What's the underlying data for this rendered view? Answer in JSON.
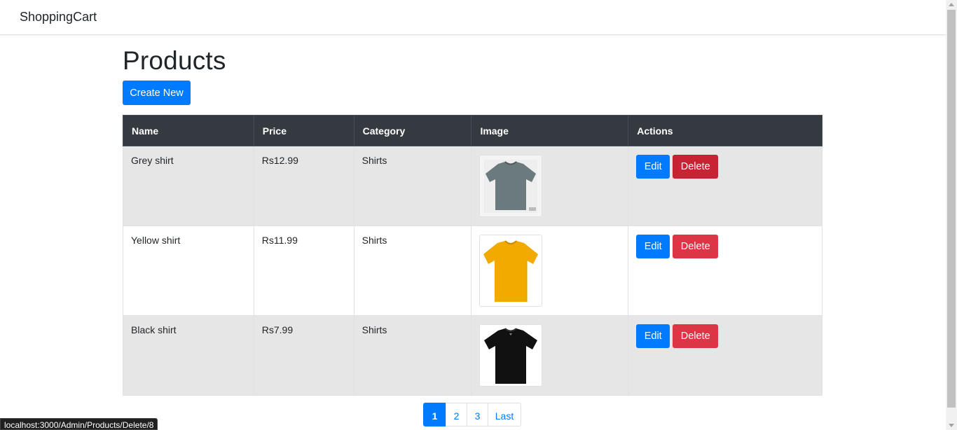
{
  "navbar": {
    "brand": "ShoppingCart"
  },
  "page": {
    "title": "Products",
    "create_button": "Create New"
  },
  "table": {
    "headers": [
      "Name",
      "Price",
      "Category",
      "Image",
      "Actions"
    ],
    "rows": [
      {
        "name": "Grey shirt",
        "price": "Rs12.99",
        "category": "Shirts",
        "image_icon": "grey-tshirt-image",
        "color": "#6b7a7d",
        "edit": "Edit",
        "delete": "Delete"
      },
      {
        "name": "Yellow shirt",
        "price": "Rs11.99",
        "category": "Shirts",
        "image_icon": "yellow-tshirt-image",
        "color": "#f2a900",
        "edit": "Edit",
        "delete": "Delete"
      },
      {
        "name": "Black shirt",
        "price": "Rs7.99",
        "category": "Shirts",
        "image_icon": "black-tshirt-image",
        "color": "#111111",
        "edit": "Edit",
        "delete": "Delete"
      }
    ]
  },
  "pagination": {
    "pages": [
      "1",
      "2",
      "3",
      "Last"
    ],
    "active": "1"
  },
  "status_bar": {
    "url": "localhost:3000/Admin/Products/Delete/8"
  },
  "colors": {
    "primary": "#007bff",
    "danger": "#dc3545",
    "header_bg": "#343a40",
    "stripe": "#e6e6e6"
  }
}
